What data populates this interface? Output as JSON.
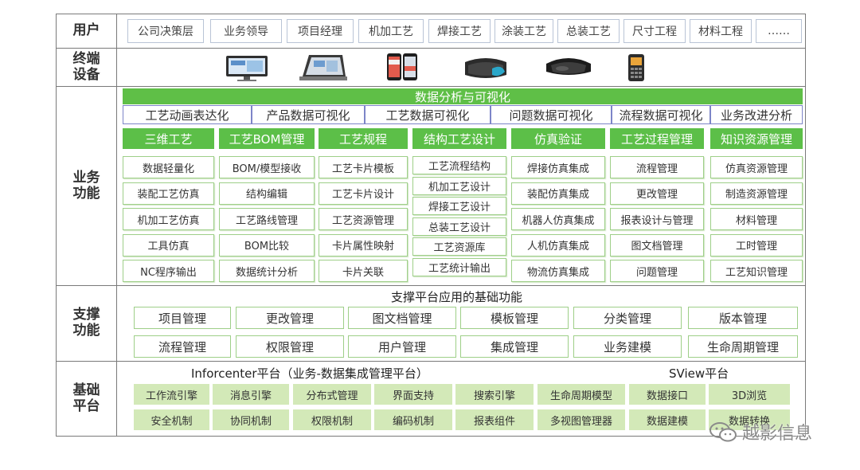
{
  "rows": {
    "user": "用户",
    "device": "终端\n设备",
    "business": "业务\n功能",
    "support": "支撑\n功能",
    "platform": "基础\n平台"
  },
  "users": [
    "公司决策层",
    "业务领导",
    "项目经理",
    "机加工艺",
    "焊接工艺",
    "涂装工艺",
    "总装工艺",
    "尺寸工程",
    "材料工程",
    "……"
  ],
  "devices": [
    "desktop-computer-icon",
    "laptop-icon",
    "smartphones-icon",
    "vr-headset-icon",
    "ar-glasses-icon",
    "handheld-terminal-icon"
  ],
  "business": {
    "banner": "数据分析与可视化",
    "viz": [
      "工艺动画表达化",
      "产品数据可视化",
      "工艺数据可视化",
      "问题数据可视化",
      "流程数据可视化",
      "业务改进分析"
    ],
    "modules": [
      {
        "title": "三维工艺",
        "items": [
          "数据轻量化",
          "装配工艺仿真",
          "机加工艺仿真",
          "工具仿真",
          "NC程序输出"
        ]
      },
      {
        "title": "工艺BOM管理",
        "items": [
          "BOM/模型接收",
          "结构编辑",
          "工艺路线管理",
          "BOM比较",
          "数据统计分析"
        ]
      },
      {
        "title": "工艺规程",
        "items": [
          "工艺卡片模板",
          "工艺卡片设计",
          "工艺资源管理",
          "卡片属性映射",
          "卡片关联"
        ]
      },
      {
        "title": "结构工艺设计",
        "items": [
          "工艺流程结构",
          "机加工艺设计",
          "焊接工艺设计",
          "总装工艺设计",
          "工艺资源库",
          "工艺统计输出"
        ]
      },
      {
        "title": "仿真验证",
        "items": [
          "焊接仿真集成",
          "装配仿真集成",
          "机器人仿真集成",
          "人机仿真集成",
          "物流仿真集成"
        ]
      },
      {
        "title": "工艺过程管理",
        "items": [
          "流程管理",
          "更改管理",
          "报表设计与管理",
          "图文档管理",
          "问题管理"
        ]
      },
      {
        "title": "知识资源管理",
        "items": [
          "仿真资源管理",
          "制造资源管理",
          "材料管理",
          "工时管理",
          "工艺知识管理"
        ]
      }
    ]
  },
  "support": {
    "title": "支撑平台应用的基础功能",
    "row1": [
      "项目管理",
      "更改管理",
      "图文档管理",
      "模板管理",
      "分类管理",
      "版本管理"
    ],
    "row2": [
      "流程管理",
      "权限管理",
      "用户管理",
      "集成管理",
      "业务建模",
      "生命周期管理"
    ]
  },
  "platform": {
    "left_title": "Inforcenter平台（业务-数据集成管理平台）",
    "right_title": "SView平台",
    "row1": [
      "工作流引擎",
      "消息引擎",
      "分布式管理",
      "界面支持",
      "搜索引擎",
      "生命周期模型",
      "数据接口",
      "3D浏览"
    ],
    "row2": [
      "安全机制",
      "协同机制",
      "权限机制",
      "编码机制",
      "报表组件",
      "多视图管理器",
      "数据建模",
      "数据转换"
    ]
  },
  "watermark": "越影信息",
  "colors": {
    "green": "#5cbf48",
    "light_green": "#d3e9b8",
    "border": "#7a7a7a",
    "viz_border": "#7d85c8"
  }
}
